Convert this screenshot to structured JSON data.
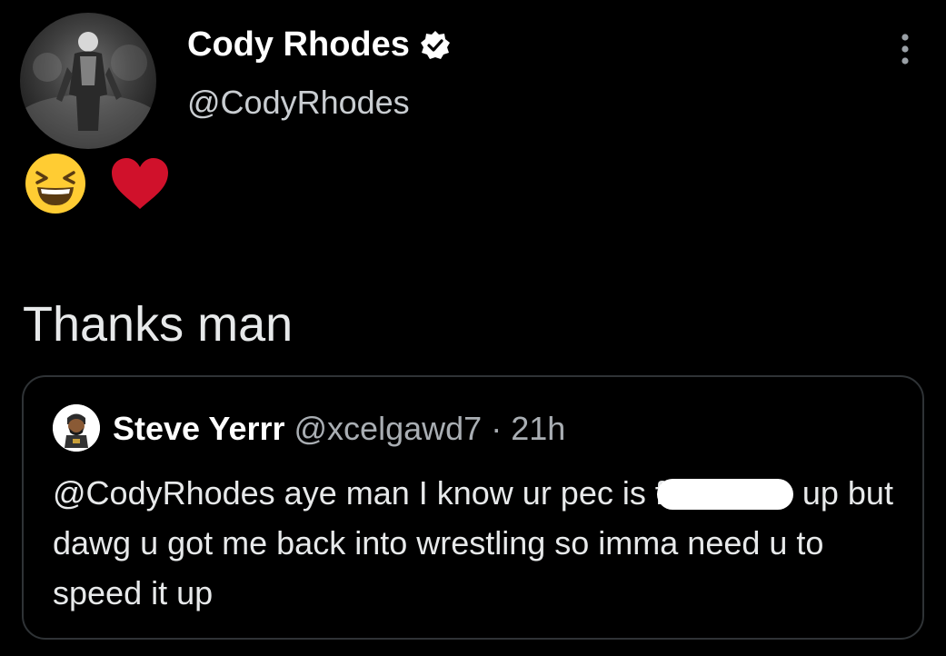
{
  "author": {
    "display_name": "Cody Rhodes",
    "handle": "@CodyRhodes",
    "avatar_icon": "avatar-photo-icon",
    "verified_icon": "verified-badge-icon"
  },
  "reactions": [
    {
      "icon": "grinning-squinting-face-icon"
    },
    {
      "icon": "red-heart-icon",
      "color": "#d0112b"
    }
  ],
  "tweet": {
    "text": "Thanks man"
  },
  "quoted_tweet": {
    "display_name": "Steve Yerrr",
    "handle": "@xcelgawd7",
    "separator": "·",
    "time": "21h",
    "text_before_redaction": "@CodyRhodes aye man I know ur pec is f",
    "text_after_redaction": " up but dawg u got me back into wrestling so imma need u to speed it up"
  },
  "colors": {
    "background": "#000000",
    "text_primary": "#e7e9ea",
    "text_secondary": "#a9aeb3",
    "border": "#2f3336"
  }
}
